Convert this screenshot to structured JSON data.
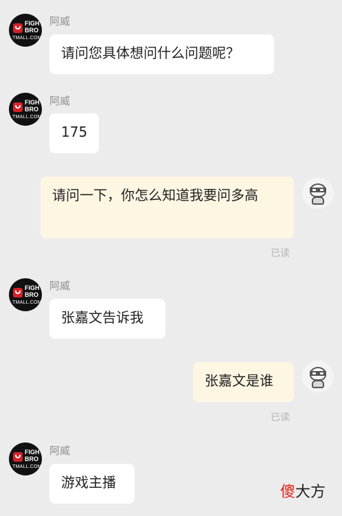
{
  "shop": {
    "sender_name": "阿威",
    "avatar_logo_line1": "FIGH",
    "avatar_logo_line2": "BRO",
    "avatar_logo_bottom": "TMALL.COM"
  },
  "messages": [
    {
      "direction": "in",
      "text": "请问您具体想问什么问题呢？"
    },
    {
      "direction": "in",
      "text": "175"
    },
    {
      "direction": "out",
      "text": "请问一下，你怎么知道我要问多高",
      "status": "已读"
    },
    {
      "direction": "in",
      "text": "张嘉文告诉我"
    },
    {
      "direction": "out",
      "text": "张嘉文是谁",
      "status": "已读"
    },
    {
      "direction": "in",
      "text": "游戏主播"
    }
  ],
  "watermark": {
    "char1": "傻",
    "rest": "大方"
  },
  "colors": {
    "background": "#ececec",
    "incoming_bubble": "#ffffff",
    "outgoing_bubble": "#fdf6e3",
    "brand_red": "#d2232a"
  }
}
